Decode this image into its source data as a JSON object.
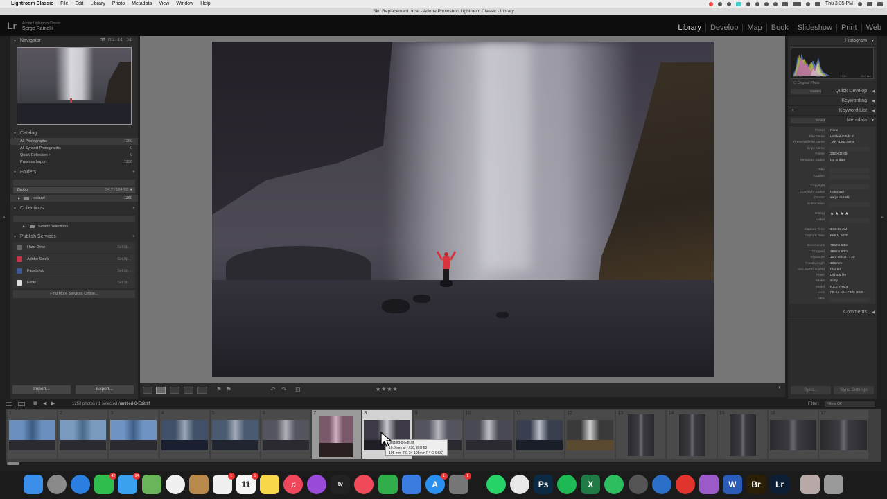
{
  "menubar": {
    "app_name": "Lightroom Classic",
    "items": [
      "File",
      "Edit",
      "Library",
      "Photo",
      "Metadata",
      "View",
      "Window",
      "Help"
    ],
    "clock": "Thu 3:35 PM"
  },
  "window": {
    "title": "Sku Replacement .lrcat - Adobe Photoshop Lightroom Classic - Library"
  },
  "identity": {
    "logo": "Lr",
    "product": "Adobe Lightroom Classic",
    "user": "Serge Ramelli"
  },
  "modules": [
    "Library",
    "Develop",
    "Map",
    "Book",
    "Slideshow",
    "Print",
    "Web"
  ],
  "active_module": "Library",
  "left_panel": {
    "navigator": {
      "title": "Navigator",
      "options": [
        "FIT",
        "FILL",
        "1:1",
        "3:1"
      ]
    },
    "catalog": {
      "title": "Catalog",
      "items": [
        {
          "label": "All Photographs",
          "count": "1250"
        },
        {
          "label": "All Synced Photographs",
          "count": "0"
        },
        {
          "label": "Quick Collection +",
          "count": "0"
        },
        {
          "label": "Previous Import",
          "count": "1250"
        }
      ]
    },
    "folders": {
      "title": "Folders",
      "volume": {
        "name": "Drobo",
        "count": "94.7 / 164 TB"
      },
      "items": [
        {
          "label": "Iceland",
          "count": "1250"
        }
      ]
    },
    "collections": {
      "title": "Collections",
      "items": [
        {
          "label": "Smart Collections"
        }
      ]
    },
    "publish": {
      "title": "Publish Services",
      "setup_label": "Set Up...",
      "items": [
        {
          "label": "Hard Drive",
          "color": "#666666"
        },
        {
          "label": "Adobe Stock",
          "color": "#c8344a"
        },
        {
          "label": "Facebook",
          "color": "#3b5998"
        },
        {
          "label": "Flickr",
          "color": "#dddddd"
        }
      ],
      "find_more": "Find More Services Online..."
    },
    "import_label": "Import...",
    "export_label": "Export..."
  },
  "toolbar": {
    "rating": "★★★★"
  },
  "right_panel": {
    "histogram": {
      "title": "Histogram",
      "iso": "ISO 50",
      "focal": "105 mm",
      "aperture": "f / 20",
      "shutter": "10.0 sec"
    },
    "original_photo": "Original Photo",
    "quick_develop": {
      "title": "Quick Develop",
      "preset": "Custom"
    },
    "keywording": "Keywording",
    "keyword_list": "Keyword List",
    "metadata": {
      "title": "Metadata",
      "preset_dropdown": "Default",
      "rows": [
        {
          "k": "Preset",
          "v": "None"
        },
        {
          "k": "File Name",
          "v": "untitled-8-Edit.tif"
        },
        {
          "k": "Preserved File Name",
          "v": "_SR_4304.ARW"
        },
        {
          "k": "Copy Name",
          "v": ""
        },
        {
          "k": "Folder",
          "v": "2020-02-06"
        },
        {
          "k": "Metadata Status",
          "v": "Up to date"
        },
        {
          "k": "Title",
          "v": ""
        },
        {
          "k": "Caption",
          "v": ""
        },
        {
          "k": "Copyright",
          "v": ""
        },
        {
          "k": "Copyright Status",
          "v": "Unknown"
        },
        {
          "k": "Creator",
          "v": "serge ramelli"
        },
        {
          "k": "Sublocation",
          "v": ""
        },
        {
          "k": "Rating",
          "v": "★ ★ ★ ★"
        },
        {
          "k": "Label",
          "v": ""
        },
        {
          "k": "Capture Time",
          "v": "3:22:46 AM"
        },
        {
          "k": "Capture Date",
          "v": "Feb 6, 2020"
        },
        {
          "k": "Dimensions",
          "v": "7952 x 5304"
        },
        {
          "k": "Cropped",
          "v": "7952 x 5304"
        },
        {
          "k": "Exposure",
          "v": "10.0 sec at f / 20"
        },
        {
          "k": "Focal Length",
          "v": "105 mm"
        },
        {
          "k": "ISO Speed Rating",
          "v": "ISO 50"
        },
        {
          "k": "Flash",
          "v": "Did not fire"
        },
        {
          "k": "Make",
          "v": "Sony"
        },
        {
          "k": "Model",
          "v": "ILCE-7RM3"
        },
        {
          "k": "Lens",
          "v": "FE 24-10... F4 G OSS"
        },
        {
          "k": "GPS",
          "v": ""
        }
      ]
    },
    "comments": "Comments",
    "sync_label": "Sync...",
    "sync_settings": "Sync Settings"
  },
  "filmstrip": {
    "info": "1250 photos / 1 selected /",
    "filename": "untitled-8-Edit.tif",
    "filter_label": "Filter :",
    "filter_value": "Filters Off",
    "cells": [
      "1",
      "2",
      "3",
      "4",
      "5",
      "6",
      "7",
      "8",
      "9",
      "10",
      "11",
      "12",
      "13",
      "14",
      "15",
      "16",
      "17"
    ],
    "tooltip_lines": [
      "untitled-8-Edit.tif",
      "10.0 sec at f / 20, ISO 50",
      "105 mm (FE 24-105mm F4 G OSS)"
    ]
  },
  "dock": {
    "apps": [
      {
        "name": "finder-icon",
        "color": "#3b8fe8",
        "glyph": ""
      },
      {
        "name": "launchpad-icon",
        "color": "#8a8a8a",
        "glyph": ""
      },
      {
        "name": "safari-icon",
        "color": "#2a7fe0",
        "glyph": ""
      },
      {
        "name": "facetime-icon",
        "color": "#2ebd4e",
        "glyph": "",
        "badge": "42"
      },
      {
        "name": "messages-icon",
        "color": "#3aa0f0",
        "glyph": "",
        "badge": "84"
      },
      {
        "name": "maps-icon",
        "color": "#6ab55a",
        "glyph": ""
      },
      {
        "name": "photos-icon",
        "color": "#f0f0f0",
        "glyph": ""
      },
      {
        "name": "contacts-icon",
        "color": "#b8894a",
        "glyph": ""
      },
      {
        "name": "reminders-icon",
        "color": "#f0f0f0",
        "glyph": "",
        "badge": "1"
      },
      {
        "name": "calendar-icon",
        "color": "#f4f4f4",
        "glyph": "11",
        "badge": "1"
      },
      {
        "name": "notes-icon",
        "color": "#f6d84a",
        "glyph": ""
      },
      {
        "name": "music-icon",
        "color": "#f0475c",
        "glyph": "♫"
      },
      {
        "name": "podcasts-icon",
        "color": "#9a4ad8",
        "glyph": ""
      },
      {
        "name": "tv-icon",
        "color": "#222222",
        "glyph": "tv"
      },
      {
        "name": "news-icon",
        "color": "#f04a5a",
        "glyph": ""
      },
      {
        "name": "numbers-icon",
        "color": "#2fae4a",
        "glyph": ""
      },
      {
        "name": "keynote-icon",
        "color": "#3a7be0",
        "glyph": ""
      },
      {
        "name": "app-store-icon",
        "color": "#2a90f0",
        "glyph": "A",
        "badge": "1"
      },
      {
        "name": "system-preferences-icon",
        "color": "#777777",
        "glyph": "",
        "badge": "1"
      },
      {
        "name": "whatsapp-icon",
        "color": "#25d366",
        "glyph": ""
      },
      {
        "name": "chrome-icon",
        "color": "#e8e8e8",
        "glyph": ""
      },
      {
        "name": "photoshop-icon",
        "color": "#0c2a44",
        "glyph": "Ps"
      },
      {
        "name": "spotify-icon",
        "color": "#1db954",
        "glyph": ""
      },
      {
        "name": "excel-icon",
        "color": "#1f7a44",
        "glyph": "X"
      },
      {
        "name": "evernote-icon",
        "color": "#2dbe60",
        "glyph": ""
      },
      {
        "name": "davinci-icon",
        "color": "#555555",
        "glyph": ""
      },
      {
        "name": "camo-icon",
        "color": "#2a6ec8",
        "glyph": ""
      },
      {
        "name": "creative-cloud-icon",
        "color": "#e0342c",
        "glyph": ""
      },
      {
        "name": "pixelmator-icon",
        "color": "#9a5ac8",
        "glyph": ""
      },
      {
        "name": "word-icon",
        "color": "#2a5cb8",
        "glyph": "W"
      },
      {
        "name": "bridge-icon",
        "color": "#2a1e06",
        "glyph": "Br"
      },
      {
        "name": "lightroom-icon",
        "color": "#0b1e33",
        "glyph": "Lr"
      },
      {
        "name": "preview-icon",
        "color": "#b8a8a8",
        "glyph": ""
      },
      {
        "name": "trash-icon",
        "color": "#9a9a9a",
        "glyph": ""
      }
    ]
  }
}
